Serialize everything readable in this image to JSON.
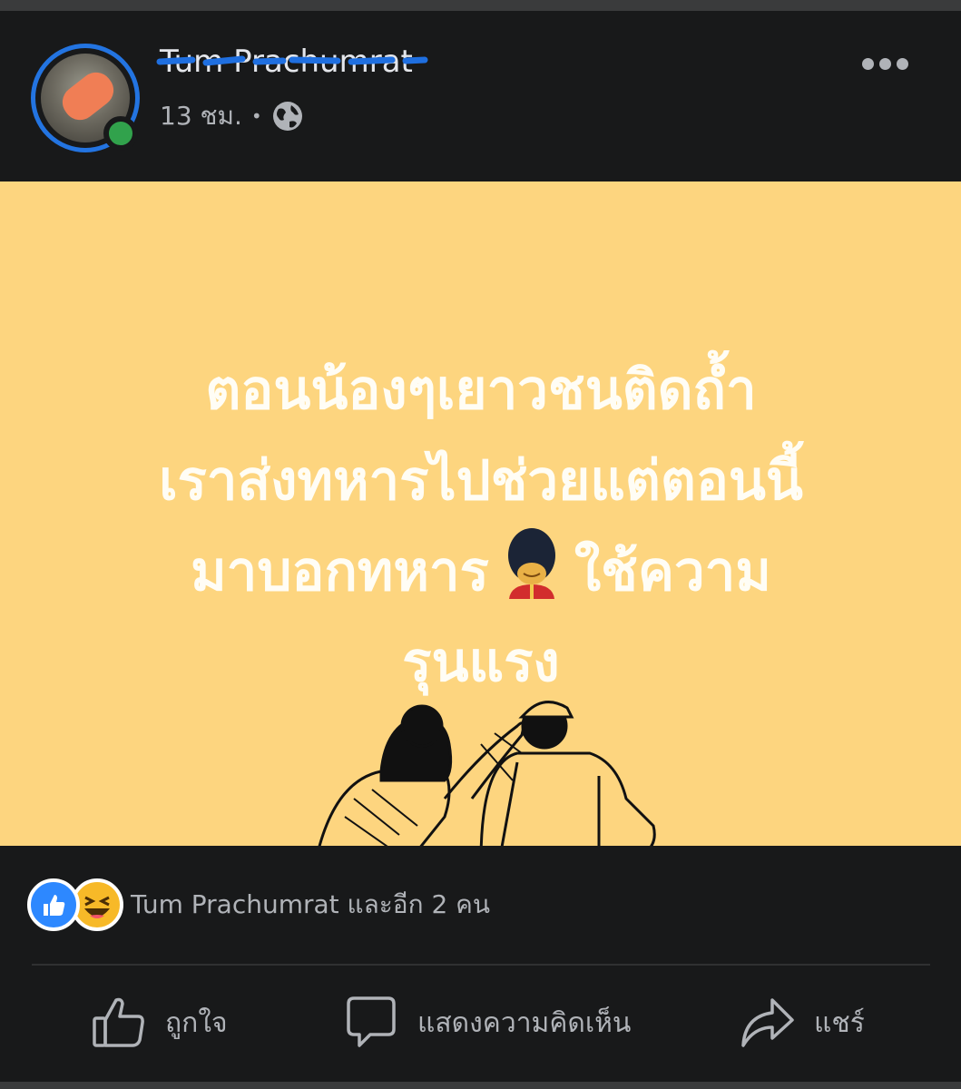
{
  "post": {
    "author_name": "Tum Prachumrat",
    "timestamp": "13 ชม.",
    "separator": "•",
    "privacy_icon": "globe-icon",
    "more_icon": "more-options-icon",
    "text_lines": [
      "ตอนน้องๆเยาวชนติดถ้ำ",
      "เราส่งทหารไปช่วยแต่ตอนนี้",
      "มาบอกทหาร",
      "ใช้ความ",
      "รุนแรง"
    ],
    "emoji": "guardsman-emoji",
    "background_color": "#fdd57f"
  },
  "reactions": {
    "icons": [
      "like-reaction-icon",
      "haha-reaction-icon"
    ],
    "summary": "Tum Prachumrat และอีก 2 คน"
  },
  "actions": {
    "like_label": "ถูกใจ",
    "comment_label": "แสดงความคิดเห็น",
    "share_label": "แชร์"
  },
  "colors": {
    "accent": "#2374e1",
    "online": "#31a24c",
    "background": "#18191a"
  }
}
